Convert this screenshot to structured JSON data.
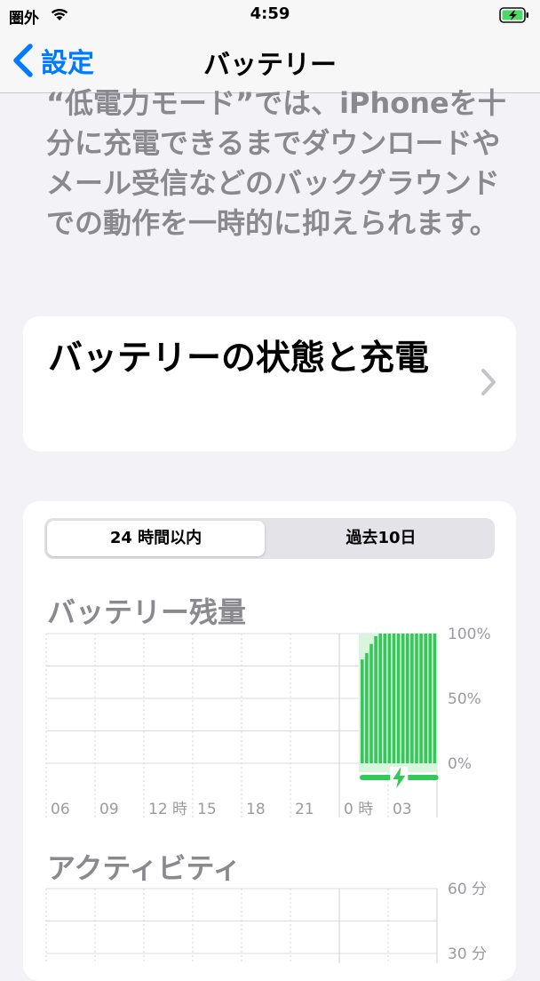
{
  "status_bar": {
    "carrier": "圏外",
    "time": "4:59"
  },
  "nav": {
    "back_label": "設定",
    "title": "バッテリー"
  },
  "description": "“低電力モード”では、iPhoneを十分に充電できるまでダウンロードやメール受信などのバックグラウンドでの動作を一時的に抑えられます。",
  "battery_health_row": {
    "label": "バッテリーの状態と充電"
  },
  "segmented": {
    "options": [
      "24 時間以内",
      "過去10日"
    ],
    "selected": "24 時間以内"
  },
  "colors": {
    "accent": "#007aff",
    "charge_green": "#34c759",
    "charge_bg": "#d9f5de",
    "battery_icon_green": "#4cd964"
  },
  "icons": [
    "wifi-icon",
    "battery-charging-icon",
    "back-chevron-icon",
    "chevron-right-icon",
    "bolt-icon"
  ],
  "chart_data": [
    {
      "type": "bar",
      "title": "バッテリー残量",
      "x_labels": [
        "06",
        "09",
        "12 時",
        "15",
        "18",
        "21",
        "0 時",
        "03"
      ],
      "y_labels": [
        "100%",
        "50%",
        "0%"
      ],
      "ylim": [
        0,
        100
      ],
      "values": [
        80,
        85,
        92,
        98,
        100,
        100,
        100,
        100,
        100,
        100,
        100,
        100,
        100,
        100,
        100,
        100,
        100
      ],
      "charging": true
    },
    {
      "type": "bar",
      "title": "アクティビティ",
      "y_labels": [
        "60 分",
        "30 分"
      ],
      "ylim": [
        0,
        60
      ],
      "values": []
    }
  ]
}
